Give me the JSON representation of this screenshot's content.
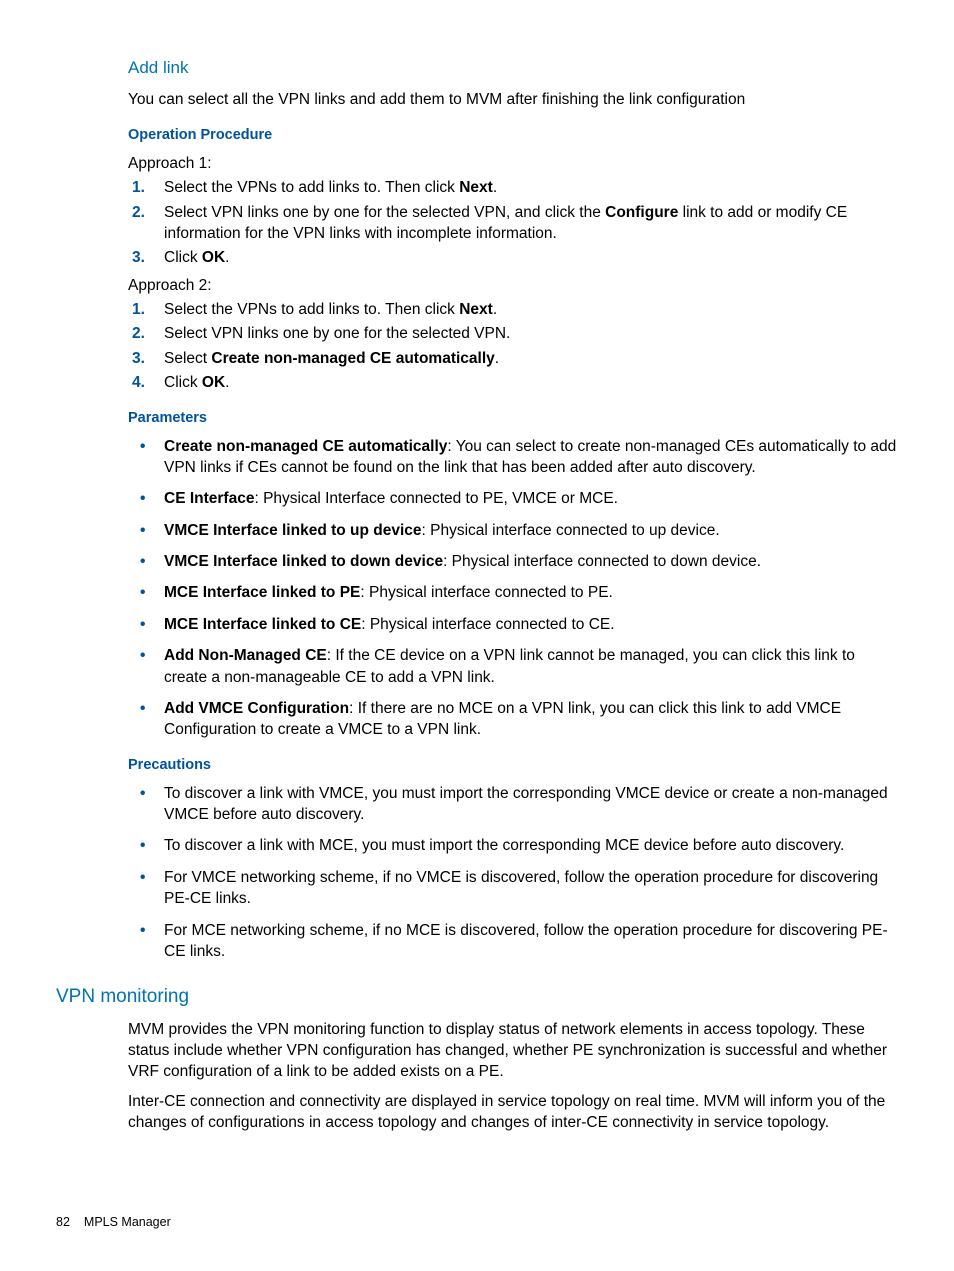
{
  "section1": {
    "title": "Add link",
    "intro": "You can select all the VPN links and add them to MVM after finishing the link configuration",
    "opProcHeading": "Operation Procedure",
    "approach1Label": "Approach 1:",
    "approach1": [
      {
        "pre": "Select the VPNs to add links to. Then click ",
        "bold": "Next",
        "post": "."
      },
      {
        "pre": "Select VPN links one by one for the selected VPN, and click the ",
        "bold": "Configure",
        "post": " link to add or modify CE information for the VPN links with incomplete information."
      },
      {
        "pre": "Click ",
        "bold": "OK",
        "post": "."
      }
    ],
    "approach2Label": "Approach 2:",
    "approach2": [
      {
        "pre": "Select the VPNs to add links to. Then click ",
        "bold": "Next",
        "post": "."
      },
      {
        "pre": "Select VPN links one by one for the selected VPN.",
        "bold": "",
        "post": ""
      },
      {
        "pre": "Select ",
        "bold": "Create non-managed CE automatically",
        "post": "."
      },
      {
        "pre": "Click ",
        "bold": "OK",
        "post": "."
      }
    ],
    "paramsHeading": "Parameters",
    "params": [
      {
        "term": "Create non-managed CE automatically",
        "text": ": You can select to create non-managed CEs automatically to add VPN links if CEs cannot be found on the link that has been added after auto discovery."
      },
      {
        "term": "CE Interface",
        "text": ": Physical Interface connected to PE, VMCE or MCE."
      },
      {
        "term": "VMCE Interface linked to up device",
        "text": ": Physical interface connected to up device."
      },
      {
        "term": "VMCE Interface linked to down device",
        "text": ": Physical interface connected to down device."
      },
      {
        "term": "MCE Interface linked to PE",
        "text": ": Physical interface connected to PE."
      },
      {
        "term": "MCE Interface linked to CE",
        "text": ": Physical interface connected to CE."
      },
      {
        "term": "Add Non-Managed CE",
        "text": ": If the CE device on a VPN link cannot be managed, you can click this link to create a non-manageable CE to add a VPN link."
      },
      {
        "term": "Add VMCE Configuration",
        "text": ": If there are no MCE on a VPN link, you can click this link to add VMCE Configuration to create a VMCE to a VPN link."
      }
    ],
    "precautionsHeading": "Precautions",
    "precautions": [
      "To discover a link with VMCE, you must import the corresponding VMCE device or create a non-managed VMCE before auto discovery.",
      "To discover a link with MCE, you must import the corresponding MCE device before auto discovery.",
      "For VMCE networking scheme, if no VMCE is discovered, follow the operation procedure for discovering PE-CE links.",
      "For MCE networking scheme, if no MCE is discovered, follow the operation procedure for discovering PE-CE links."
    ]
  },
  "section2": {
    "title": "VPN monitoring",
    "p1": "MVM provides the VPN monitoring function to display status of network elements in access topology. These status include whether VPN configuration has changed, whether PE synchronization is successful and whether VRF configuration of a link to be added exists on a PE.",
    "p2": "Inter-CE connection and connectivity are displayed in service topology on real time. MVM will inform you of the changes of configurations in access topology and changes of inter-CE connectivity in service topology."
  },
  "footer": {
    "pageNum": "82",
    "chapter": "MPLS Manager"
  }
}
